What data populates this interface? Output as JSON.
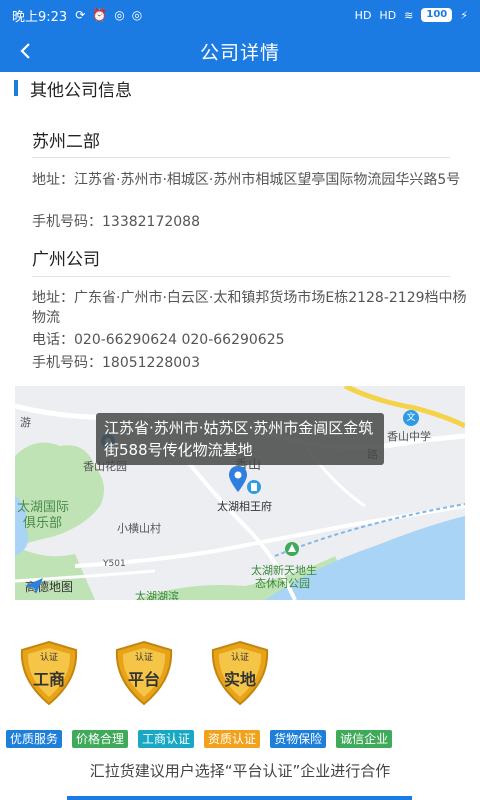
{
  "status_bar": {
    "time": "晚上9:23",
    "signal1": "HD",
    "signal2": "HD",
    "battery": "100"
  },
  "nav": {
    "back_icon": "chevron-left-icon",
    "title": "公司详情"
  },
  "section": {
    "title": "其他公司信息"
  },
  "companies": [
    {
      "name": "苏州二部",
      "address_label": "地址：",
      "address": "江苏省·苏州市·相城区·苏州市相城区望亭国际物流园华兴路5号",
      "phone_label": "手机号码：",
      "phone": "13382172088"
    },
    {
      "name": "广州公司",
      "address_label": "地址：",
      "address": "广东省·广州市·白云区·太和镇邦货场市场E栋2128-2129档中杨物流",
      "tel_label": "电话：",
      "tel": "020-66290624 020-66290625",
      "phone_label": "手机号码：",
      "phone": "18051228003"
    }
  ],
  "map": {
    "overlay_address": "江苏省·苏州市·姑苏区·苏州市金阊区金筑街588号传化物流基地",
    "labels": {
      "you": "游",
      "wen": "文",
      "xiangshan_garden": "香山花园",
      "xiangshan": "香山",
      "xiangshan_school": "香山中学",
      "taihu_club_line1": "太湖国际",
      "taihu_club_line2": "俱乐部",
      "xiaohengshan": "小横山村",
      "taihu_xiangwangfu": "太湖相王府",
      "road": "Y501",
      "park_line1": "太湖新天地生",
      "park_line2": "态休闲公园",
      "lu": "路",
      "bottom": "太湖湖滨"
    },
    "provider": "高德地图"
  },
  "badges": [
    {
      "top": "认证",
      "label": "工商"
    },
    {
      "top": "认证",
      "label": "平台"
    },
    {
      "top": "认证",
      "label": "实地"
    }
  ],
  "tags": [
    {
      "label": "优质服务",
      "color": "#1E7FD8"
    },
    {
      "label": "价格合理",
      "color": "#3FAA5A"
    },
    {
      "label": "工商认证",
      "color": "#19A8C4"
    },
    {
      "label": "资质认证",
      "color": "#F0A21C"
    },
    {
      "label": "货物保险",
      "color": "#1E7FD8"
    },
    {
      "label": "诚信企业",
      "color": "#3FAA5A"
    }
  ],
  "footer": {
    "text": "汇拉货建议用户选择“平台认证”企业进行合作"
  },
  "colors": {
    "primary": "#1B7BE3",
    "badge_gold": "#E8A418"
  }
}
